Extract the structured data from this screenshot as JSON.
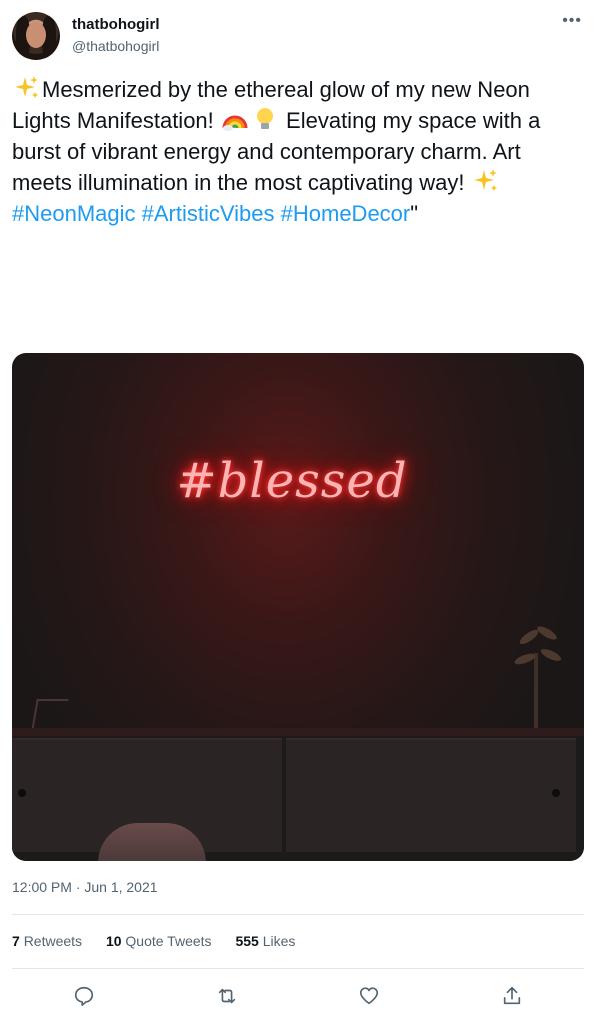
{
  "user": {
    "display_name": "thatbohogirl",
    "handle": "@thatbohogirl"
  },
  "tweet": {
    "text_1": "Mesmerized by the ethereal glow of my new Neon Lights Manifestation!",
    "text_2": "Elevating my space with a burst of vibrant energy and contemporary charm. Art meets illumination in the most captivating way!",
    "hashtags": [
      "#NeonMagic",
      "#ArtisticVibes",
      "#HomeDecor"
    ],
    "trailing": "\""
  },
  "media": {
    "neon_text": "#blessed"
  },
  "meta": {
    "timestamp": "12:00 PM · Jun 1, 2021"
  },
  "stats": {
    "retweets_count": "7",
    "retweets_label": "Retweets",
    "quotes_count": "10",
    "quotes_label": "Quote Tweets",
    "likes_count": "555",
    "likes_label": "Likes"
  },
  "icons": {
    "more": "more-horizontal-icon",
    "reply": "reply-icon",
    "retweet": "retweet-icon",
    "like": "heart-icon",
    "share": "share-icon"
  },
  "colors": {
    "link": "#1d9bf0",
    "secondary_text": "#536471",
    "neon": "#ff2a2a"
  }
}
